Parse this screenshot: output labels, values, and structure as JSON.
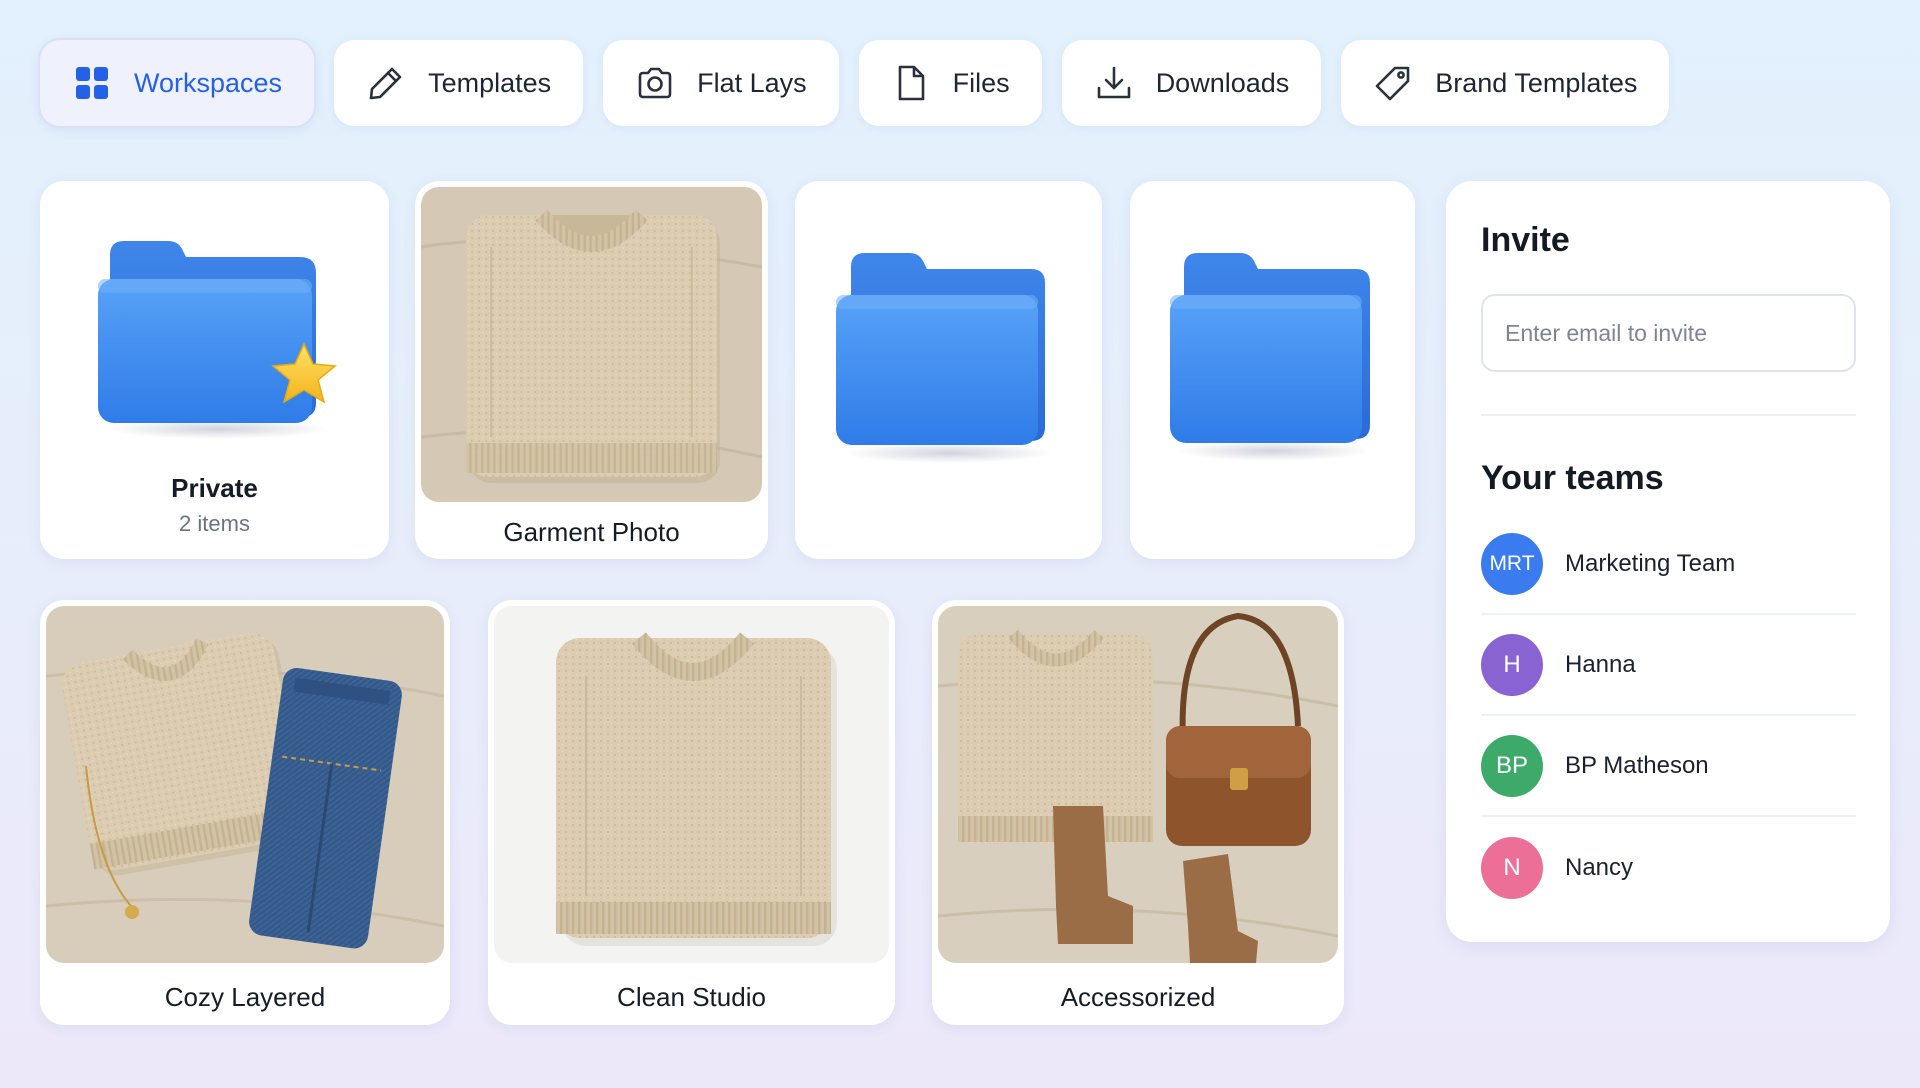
{
  "tabs": [
    {
      "label": "Workspaces",
      "icon": "grid-icon",
      "active": true
    },
    {
      "label": "Templates",
      "icon": "pencil-icon",
      "active": false
    },
    {
      "label": "Flat Lays",
      "icon": "camera-icon",
      "active": false
    },
    {
      "label": "Files",
      "icon": "file-icon",
      "active": false
    },
    {
      "label": "Downloads",
      "icon": "download-icon",
      "active": false
    },
    {
      "label": "Brand Templates",
      "icon": "tag-icon",
      "active": false
    }
  ],
  "folders": [
    {
      "label": "Private",
      "sublabel": "2 items",
      "icon": "starred-folder-icon"
    },
    {
      "label": "",
      "icon": "folder-icon"
    },
    {
      "label": "",
      "icon": "folder-icon"
    }
  ],
  "photos": [
    {
      "label": "Garment Photo"
    },
    {
      "label": "Cozy Layered"
    },
    {
      "label": "Clean Studio"
    },
    {
      "label": "Accessorized"
    }
  ],
  "invite": {
    "title": "Invite",
    "email_placeholder": "Enter email to invite"
  },
  "teams": {
    "title": "Your teams",
    "items": [
      {
        "initials": "MRT",
        "name": "Marketing Team",
        "color": "#3a7cf0"
      },
      {
        "initials": "H",
        "name": "Hanna",
        "color": "#8a63d2"
      },
      {
        "initials": "BP",
        "name": "BP Matheson",
        "color": "#3eaa6a"
      },
      {
        "initials": "N",
        "name": "Nancy",
        "color": "#ec6f97"
      }
    ]
  },
  "colors": {
    "accent": "#2461e6",
    "folder_blue": "#3d8ef2",
    "star_yellow": "#f7c530",
    "sweater": "#dccdb2",
    "linen": "#d7ccba"
  }
}
